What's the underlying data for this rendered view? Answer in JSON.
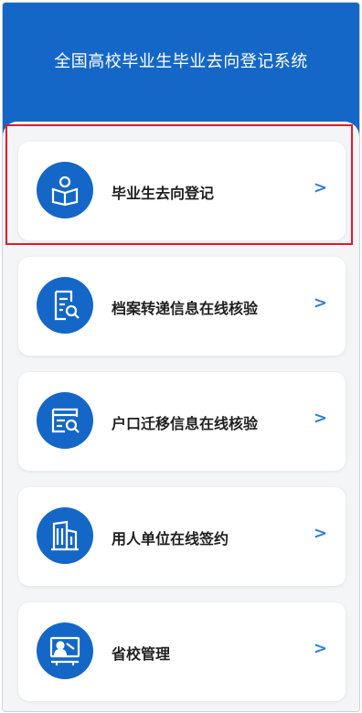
{
  "header": {
    "title": "全国高校毕业生毕业去向登记系统"
  },
  "menu": [
    {
      "label": "毕业生去向登记",
      "icon": "student-reading-icon",
      "arrow": ">"
    },
    {
      "label": "档案转递信息在线核验",
      "icon": "document-search-icon",
      "arrow": ">"
    },
    {
      "label": "户口迁移信息在线核验",
      "icon": "register-search-icon",
      "arrow": ">"
    },
    {
      "label": "用人单位在线签约",
      "icon": "building-icon",
      "arrow": ">"
    },
    {
      "label": "省校管理",
      "icon": "teacher-board-icon",
      "arrow": ">"
    }
  ],
  "colors": {
    "brand": "#1467c6",
    "arrow": "#2e80d8",
    "highlight": "#e3182b"
  }
}
